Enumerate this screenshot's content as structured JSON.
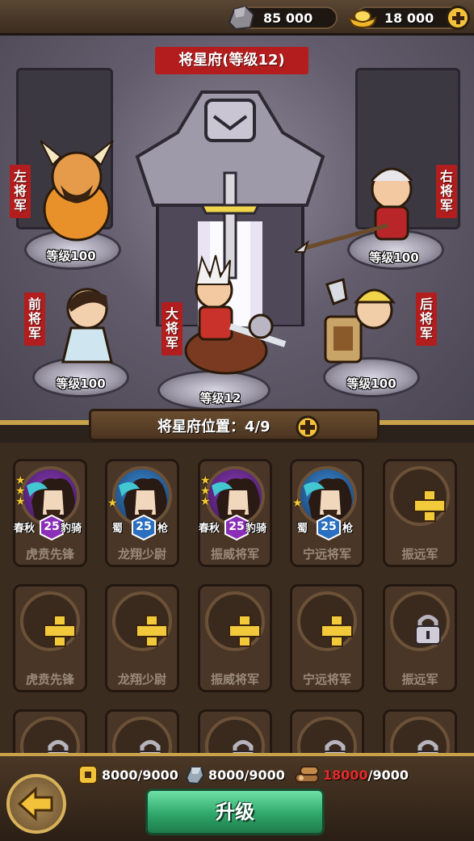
{
  "resources": {
    "stone": {
      "value": "85 000",
      "icon": "stone-icon"
    },
    "gold": {
      "value": "18 000",
      "icon": "gold-ingot-icon"
    }
  },
  "scene": {
    "title": "将星府(等级12)",
    "heroes": [
      {
        "role": "左将军",
        "level": "等级100"
      },
      {
        "role": "右将军",
        "level": "等级100"
      },
      {
        "role": "前将军",
        "level": "等级100"
      },
      {
        "role": "大将军",
        "level": "等级12"
      },
      {
        "role": "后将军",
        "level": "等级100"
      }
    ]
  },
  "positions": {
    "label": "将星府位置：4/9"
  },
  "slots": [
    {
      "name": "虎贲先锋",
      "state": "filled",
      "stars": 3,
      "level": "25",
      "faction": "春秋",
      "unit": "豹骑",
      "color": "purple"
    },
    {
      "name": "龙翔少尉",
      "state": "filled",
      "stars": 1,
      "level": "25",
      "faction": "蜀",
      "unit": "枪",
      "color": "blue"
    },
    {
      "name": "振威将军",
      "state": "filled",
      "stars": 3,
      "level": "25",
      "faction": "春秋",
      "unit": "豹骑",
      "color": "purple"
    },
    {
      "name": "宁远将军",
      "state": "filled",
      "stars": 1,
      "level": "25",
      "faction": "蜀",
      "unit": "枪",
      "color": "blue"
    },
    {
      "name": "振远军",
      "state": "empty"
    },
    {
      "name": "虎贲先锋",
      "state": "empty"
    },
    {
      "name": "龙翔少尉",
      "state": "empty"
    },
    {
      "name": "振威将军",
      "state": "empty"
    },
    {
      "name": "宁远将军",
      "state": "empty"
    },
    {
      "name": "振远军",
      "state": "locked"
    }
  ],
  "costs": [
    {
      "icon": "gold-coin-icon",
      "have": "8000",
      "need": "/9000",
      "insufficient": false
    },
    {
      "icon": "iron-icon",
      "have": "8000",
      "need": "/9000",
      "insufficient": false
    },
    {
      "icon": "wood-icon",
      "have": "18000",
      "need": "/9000",
      "insufficient": true
    }
  ],
  "buttons": {
    "upgrade": "升级",
    "back_icon": "back-arrow-icon"
  },
  "colors": {
    "banner_red": "#b31d1d",
    "gold": "#f2c93b",
    "upgrade_green": "#2fa86b",
    "insufficient": "#e52b2b"
  }
}
